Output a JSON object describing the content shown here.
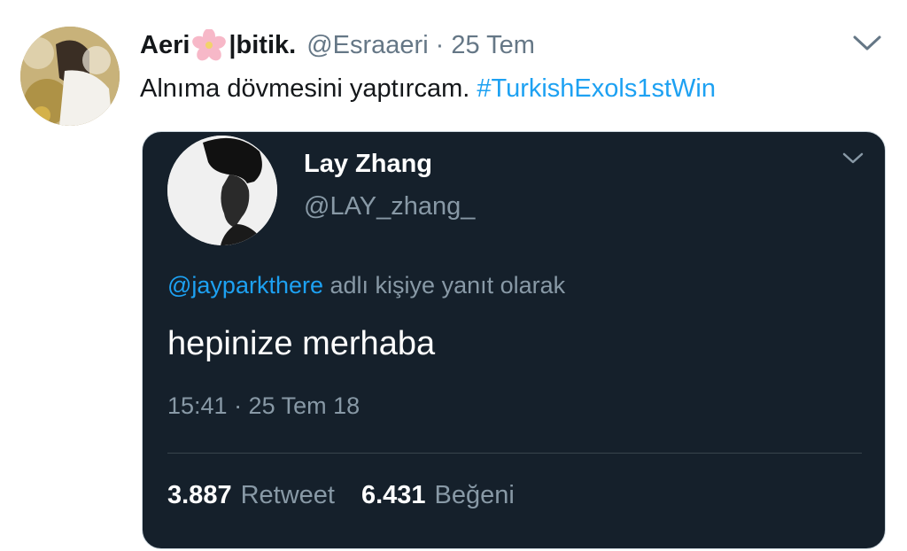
{
  "tweet": {
    "display_name_part1": "Aeri",
    "display_name_part2": "|bitik.",
    "handle": "@Esraaeri",
    "separator": "·",
    "time": "25 Tem",
    "text": "Alnıma dövmesini yaptırcam.",
    "hashtag": "#TurkishExols1stWin"
  },
  "quoted": {
    "name": "Lay Zhang",
    "handle": "@LAY_zhang_",
    "reply_mention": "@jayparkthere",
    "reply_suffix": "adlı kişiye yanıt olarak",
    "body": "hepinize merhaba",
    "timestamp": "15:41 · 25 Tem 18",
    "retweet_count": "3.887",
    "retweet_label": "Retweet",
    "like_count": "6.431",
    "like_label": "Beğeni"
  },
  "icons": {
    "flower": "cherry-blossom-icon",
    "menu_chevron": "chevron-down-icon"
  },
  "colors": {
    "link": "#1da1f2",
    "card_background": "#15202b",
    "muted": "#657786"
  }
}
